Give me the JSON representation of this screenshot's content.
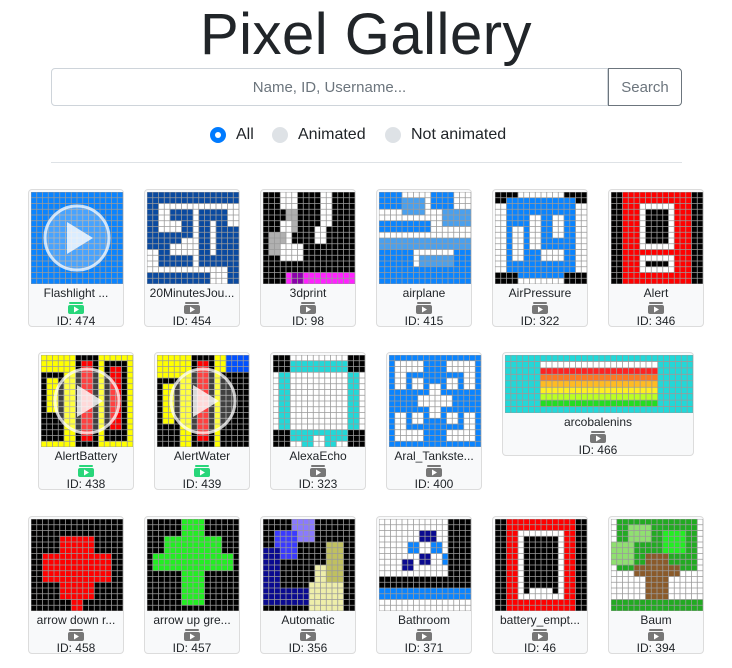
{
  "app": {
    "title": "Pixel Gallery"
  },
  "search": {
    "placeholder": "Name, ID, Username...",
    "value": "",
    "button": "Search"
  },
  "filters": {
    "selected": "All",
    "options": [
      {
        "label": "All",
        "checked": true
      },
      {
        "label": "Animated",
        "checked": false
      },
      {
        "label": "Not animated",
        "checked": false
      }
    ]
  },
  "colors": {
    "accent": "#007bff",
    "animated_badge": "#28d67a",
    "static_badge": "#777777"
  },
  "gallery": [
    {
      "name": "Flashlight ...",
      "id": "ID: 474",
      "animated": true,
      "thumb": "flashlight"
    },
    {
      "name": "20MinutesJou...",
      "id": "ID: 454",
      "animated": false,
      "thumb": "20min"
    },
    {
      "name": "3dprint",
      "id": "ID: 98",
      "animated": false,
      "thumb": "3dprint"
    },
    {
      "name": "airplane",
      "id": "ID: 415",
      "animated": false,
      "thumb": "airplane"
    },
    {
      "name": "AirPressure",
      "id": "ID: 322",
      "animated": false,
      "thumb": "airpressure"
    },
    {
      "name": "Alert",
      "id": "ID: 346",
      "animated": false,
      "thumb": "alert"
    },
    {
      "name": "AlertBattery",
      "id": "ID: 438",
      "animated": true,
      "thumb": "alertbattery"
    },
    {
      "name": "AlertWater",
      "id": "ID: 439",
      "animated": true,
      "thumb": "alertwater"
    },
    {
      "name": "AlexaEcho",
      "id": "ID: 323",
      "animated": false,
      "thumb": "alexa"
    },
    {
      "name": "Aral_Tankste...",
      "id": "ID: 400",
      "animated": false,
      "thumb": "aral"
    },
    {
      "name": "arcobalenins",
      "id": "ID: 466",
      "animated": false,
      "thumb": "rainbow"
    },
    {
      "name": "arrow down r...",
      "id": "ID: 458",
      "animated": false,
      "thumb": "arrowdown"
    },
    {
      "name": "arrow up gre...",
      "id": "ID: 457",
      "animated": false,
      "thumb": "arrowup"
    },
    {
      "name": "Automatic",
      "id": "ID: 356",
      "animated": false,
      "thumb": "automatic"
    },
    {
      "name": "Bathroom",
      "id": "ID: 371",
      "animated": false,
      "thumb": "bathroom"
    },
    {
      "name": "battery_empt...",
      "id": "ID: 46",
      "animated": false,
      "thumb": "battery"
    },
    {
      "name": "Baum",
      "id": "ID: 394",
      "animated": false,
      "thumb": "baum"
    }
  ]
}
